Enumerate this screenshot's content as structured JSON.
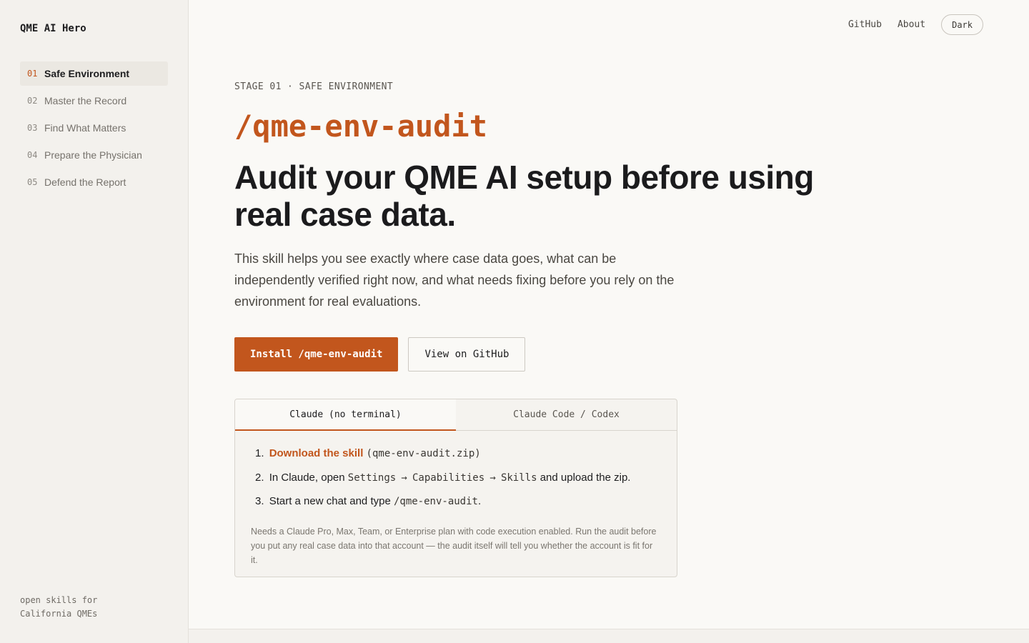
{
  "sidebar": {
    "brand": "QME AI Hero",
    "items": [
      {
        "num": "01",
        "label": "Safe Environment",
        "active": true
      },
      {
        "num": "02",
        "label": "Master the Record",
        "active": false
      },
      {
        "num": "03",
        "label": "Find What Matters",
        "active": false
      },
      {
        "num": "04",
        "label": "Prepare the Physician",
        "active": false
      },
      {
        "num": "05",
        "label": "Defend the Report",
        "active": false
      }
    ],
    "footer_line1": "open skills for",
    "footer_line2": "California QMEs"
  },
  "topnav": {
    "github": "GitHub",
    "about": "About",
    "theme_toggle": "Dark"
  },
  "hero": {
    "eyebrow": "STAGE 01 · SAFE ENVIRONMENT",
    "command": "/qme-env-audit",
    "headline": "Audit your QME AI setup before using real case data.",
    "lede": "This skill helps you see exactly where case data goes, what can be independently verified right now, and what needs fixing before you rely on the environment for real evaluations.",
    "primary_button": "Install /qme-env-audit",
    "secondary_button": "View on GitHub"
  },
  "install_card": {
    "tabs": [
      {
        "label": "Claude (no terminal)",
        "active": true
      },
      {
        "label": "Claude Code / Codex",
        "active": false
      }
    ],
    "step1_num": "1.",
    "step1_link": "Download the skill",
    "step1_file": "(qme-env-audit.zip)",
    "step2_num": "2.",
    "step2_pre": "In Claude, open",
    "step2_path1": "Settings",
    "step2_arrow1": "→",
    "step2_path2": "Capabilities",
    "step2_arrow2": "→",
    "step2_path3": "Skills",
    "step2_post": "and upload the zip.",
    "step3_num": "3.",
    "step3_pre": "Start a new chat and type",
    "step3_cmd": "/qme-env-audit",
    "step3_post": ".",
    "note": "Needs a Claude Pro, Max, Team, or Enterprise plan with code execution enabled. Run the audit before you put any real case data into that account — the audit itself will tell you whether the account is fit for it."
  }
}
